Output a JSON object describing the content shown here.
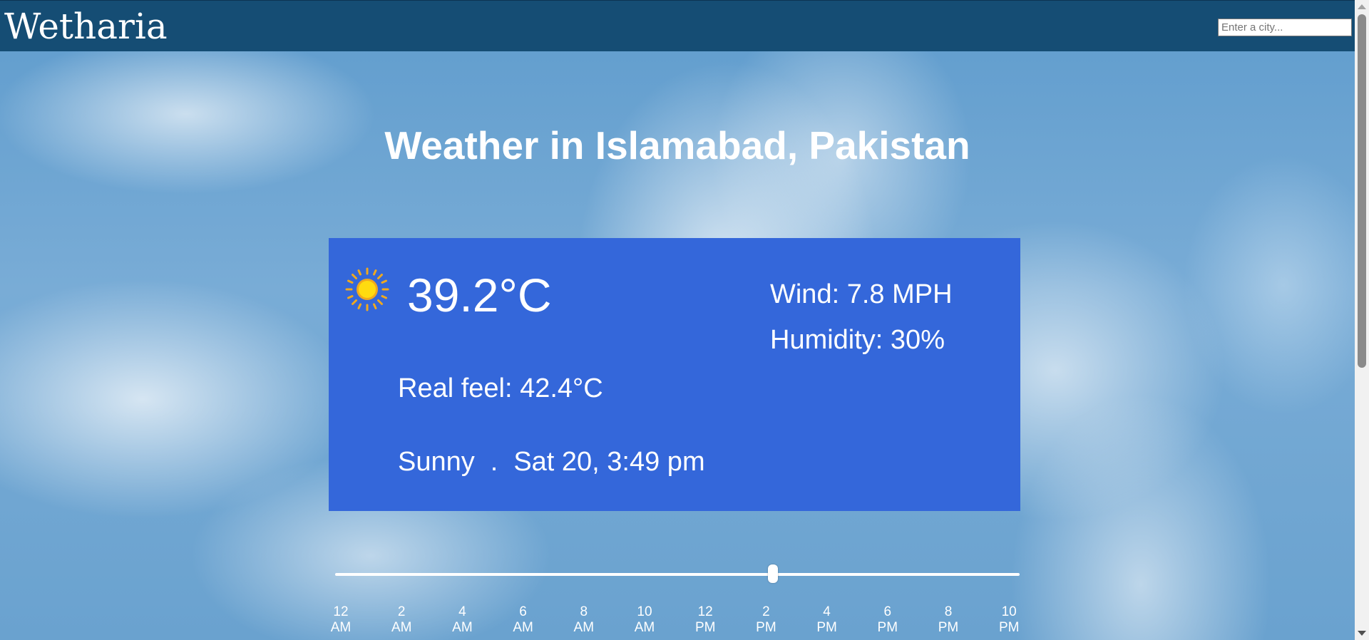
{
  "app": {
    "brand": "Wetharia",
    "search_placeholder": "Enter a city..."
  },
  "main": {
    "title": "Weather in Islamabad, Pakistan"
  },
  "weather": {
    "icon": "sun-icon",
    "temperature": "39.2°C",
    "wind": "Wind: 7.8 MPH",
    "humidity": "Humidity: 30%",
    "real_feel": "Real feel: 42.4°C",
    "condition": "Sunny",
    "separator": ".",
    "datetime": "Sat 20, 3:49 pm"
  },
  "timeline": {
    "selected_fraction": 0.64,
    "ticks": [
      {
        "hour": "12",
        "period": "AM"
      },
      {
        "hour": "2",
        "period": "AM"
      },
      {
        "hour": "4",
        "period": "AM"
      },
      {
        "hour": "6",
        "period": "AM"
      },
      {
        "hour": "8",
        "period": "AM"
      },
      {
        "hour": "10",
        "period": "AM"
      },
      {
        "hour": "12",
        "period": "PM"
      },
      {
        "hour": "2",
        "period": "PM"
      },
      {
        "hour": "4",
        "period": "PM"
      },
      {
        "hour": "6",
        "period": "PM"
      },
      {
        "hour": "8",
        "period": "PM"
      },
      {
        "hour": "10",
        "period": "PM"
      }
    ]
  },
  "colors": {
    "navbar": "#154d74",
    "card": "#3467da",
    "text": "#ffffff"
  }
}
